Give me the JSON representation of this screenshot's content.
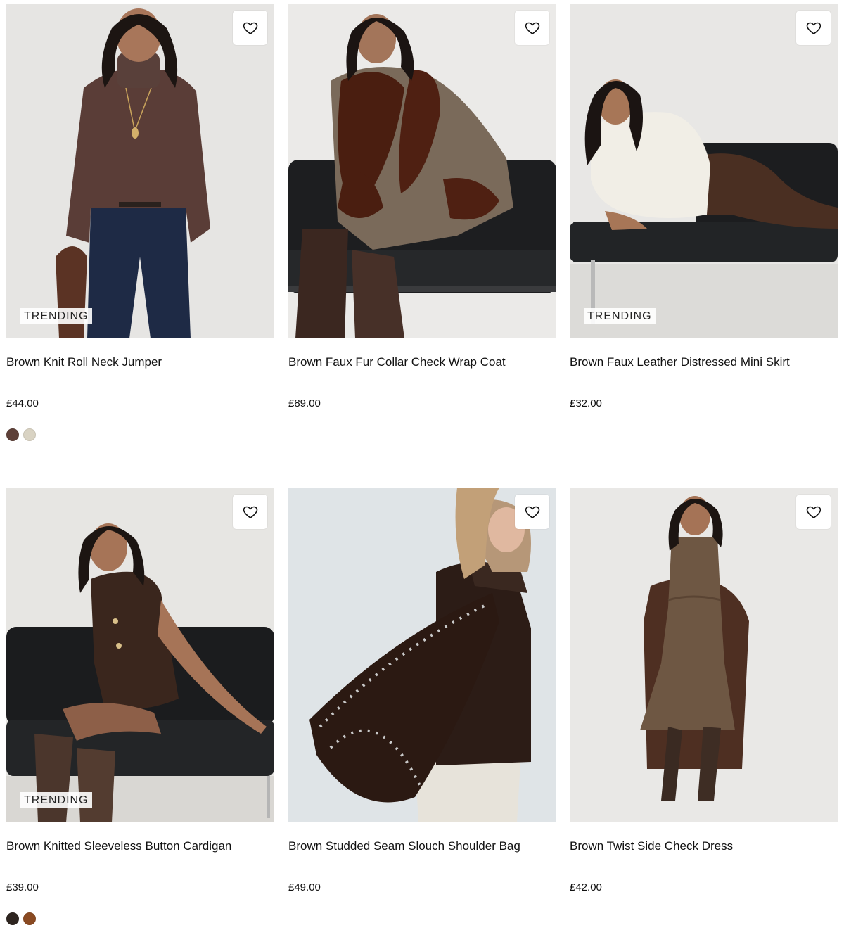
{
  "badge_label": "TRENDING",
  "products": [
    {
      "title": "Brown Knit Roll Neck Jumper",
      "price": "£44.00",
      "trending": true,
      "swatches": [
        {
          "color": "#5e4038"
        },
        {
          "color": "#d9d3c3"
        }
      ]
    },
    {
      "title": "Brown Faux Fur Collar Check Wrap Coat",
      "price": "£89.00",
      "trending": false,
      "swatches": []
    },
    {
      "title": "Brown Faux Leather Distressed Mini Skirt",
      "price": "£32.00",
      "trending": true,
      "swatches": []
    },
    {
      "title": "Brown Knitted Sleeveless Button Cardigan",
      "price": "£39.00",
      "trending": true,
      "swatches": [
        {
          "color": "#2e2520"
        },
        {
          "color": "#8a4a22"
        }
      ]
    },
    {
      "title": "Brown Studded Seam Slouch Shoulder Bag",
      "price": "£49.00",
      "trending": false,
      "swatches": []
    },
    {
      "title": "Brown Twist Side Check Dress",
      "price": "£42.00",
      "trending": false,
      "swatches": []
    }
  ],
  "icons": {
    "wishlist": "heart-outline-icon"
  }
}
